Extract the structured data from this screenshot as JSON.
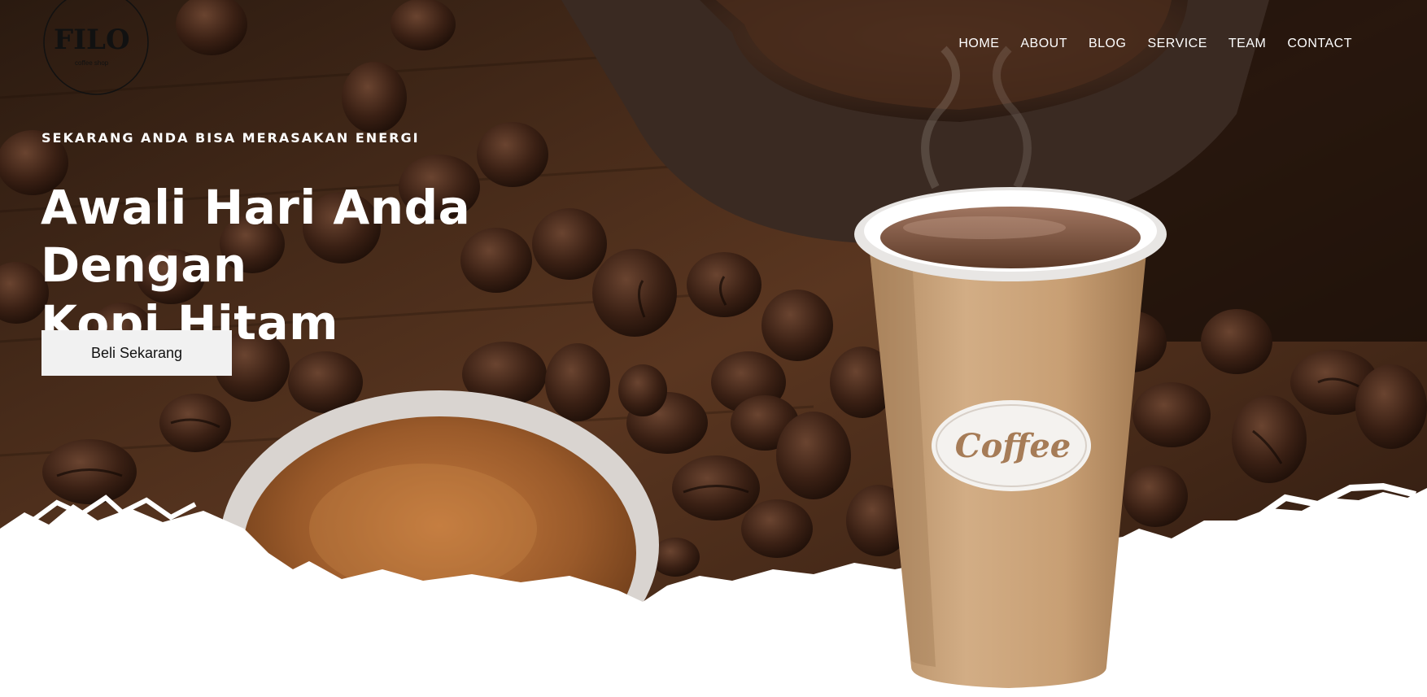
{
  "brand": {
    "logo_text": "FILO",
    "logo_subtext": "coffee shop"
  },
  "nav": {
    "items": [
      {
        "label": "HOME"
      },
      {
        "label": "ABOUT"
      },
      {
        "label": "BLOG"
      },
      {
        "label": "SERVICE"
      },
      {
        "label": "TEAM"
      },
      {
        "label": "CONTACT"
      }
    ]
  },
  "hero": {
    "eyebrow": "SEKARANG ANDA BISA MERASAKAN ENERGI",
    "headline_line1": "Awali Hari Anda Dengan",
    "headline_line2": "Kopi Hitam",
    "cta_label": "Beli Sekarang",
    "cup_label": "Coffee"
  },
  "colors": {
    "nav_text": "#ffffff",
    "cta_bg": "#f1f1f1",
    "cup": "#c9a47c",
    "coffee": "#6b4430"
  }
}
